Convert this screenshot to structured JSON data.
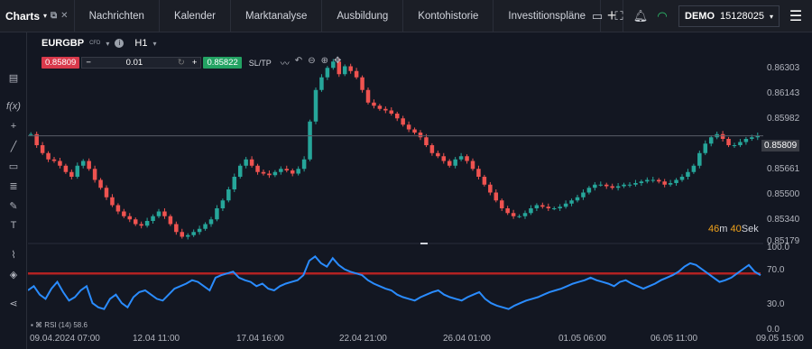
{
  "nav": {
    "brand": "Charts",
    "tabs": [
      "Nachrichten",
      "Kalender",
      "Marktanalyse",
      "Ausbildung",
      "Kontohistorie",
      "Investitionspläne"
    ],
    "plus": "+",
    "account_type": "DEMO",
    "account_number": "15128025"
  },
  "instrument": {
    "symbol": "EURGBP",
    "badge": "CFD",
    "timeframe": "H1",
    "sell_price": "0.85809",
    "buy_price": "0.85822",
    "quantity": "0.01",
    "minus": "−",
    "plus": "+",
    "sltp": "SL/TP"
  },
  "chart_data": {
    "type": "candlestick",
    "y_axis_ticks": [
      "0.86303",
      "0.86143",
      "0.85982",
      "0.85809",
      "0.85661",
      "0.85500",
      "0.85340",
      "0.85179"
    ],
    "current_price": "0.85809",
    "x_axis_ticks": [
      "09.04.2024 07:00",
      "12.04 11:00",
      "17.04 16:00",
      "22.04 21:00",
      "26.04 01:00",
      "01.05 06:00",
      "06.05 11:00",
      "09.05 15:00"
    ],
    "close": [
      0.8582,
      0.8575,
      0.857,
      0.8566,
      0.8565,
      0.8562,
      0.8558,
      0.8555,
      0.8562,
      0.8565,
      0.856,
      0.8553,
      0.8548,
      0.8542,
      0.8537,
      0.8533,
      0.853,
      0.8528,
      0.8525,
      0.8524,
      0.8527,
      0.853,
      0.8533,
      0.853,
      0.8525,
      0.852,
      0.8517,
      0.8518,
      0.852,
      0.8522,
      0.8525,
      0.8528,
      0.8535,
      0.854,
      0.8547,
      0.8555,
      0.8562,
      0.8566,
      0.8562,
      0.8558,
      0.8557,
      0.8556,
      0.8558,
      0.856,
      0.8559,
      0.8557,
      0.856,
      0.8566,
      0.859,
      0.861,
      0.8618,
      0.8624,
      0.8628,
      0.862,
      0.8625,
      0.8622,
      0.8618,
      0.861,
      0.8602,
      0.86,
      0.8598,
      0.8597,
      0.8595,
      0.8592,
      0.8588,
      0.8585,
      0.8583,
      0.858,
      0.8575,
      0.857,
      0.8568,
      0.8565,
      0.8562,
      0.8566,
      0.8568,
      0.8565,
      0.856,
      0.8555,
      0.855,
      0.8545,
      0.854,
      0.8535,
      0.8532,
      0.853,
      0.853,
      0.8532,
      0.8535,
      0.8537,
      0.8536,
      0.8535,
      0.8535,
      0.8536,
      0.8538,
      0.854,
      0.8542,
      0.8545,
      0.8548,
      0.855,
      0.855,
      0.8549,
      0.8548,
      0.8549,
      0.855,
      0.855,
      0.8551,
      0.8552,
      0.8553,
      0.8553,
      0.8552,
      0.855,
      0.8551,
      0.8553,
      0.8555,
      0.8558,
      0.8562,
      0.857,
      0.8576,
      0.858,
      0.8582,
      0.8579,
      0.8575,
      0.8575,
      0.8577,
      0.8579,
      0.858,
      0.8581
    ],
    "rsi": [
      50,
      55,
      45,
      40,
      52,
      60,
      48,
      38,
      42,
      50,
      55,
      35,
      30,
      28,
      40,
      45,
      35,
      30,
      42,
      48,
      50,
      45,
      40,
      38,
      45,
      52,
      55,
      58,
      62,
      60,
      55,
      50,
      65,
      68,
      70,
      72,
      65,
      62,
      60,
      55,
      58,
      52,
      50,
      55,
      58,
      60,
      62,
      68,
      85,
      90,
      82,
      78,
      88,
      80,
      75,
      72,
      70,
      68,
      62,
      58,
      55,
      52,
      50,
      45,
      42,
      40,
      38,
      42,
      45,
      48,
      50,
      45,
      42,
      40,
      38,
      42,
      45,
      48,
      40,
      35,
      32,
      30,
      28,
      32,
      35,
      38,
      40,
      42,
      45,
      48,
      50,
      52,
      55,
      58,
      60,
      62,
      65,
      62,
      60,
      58,
      55,
      60,
      62,
      58,
      55,
      52,
      55,
      58,
      62,
      65,
      68,
      72,
      78,
      82,
      80,
      75,
      70,
      65,
      60,
      62,
      65,
      70,
      75,
      80,
      72,
      68
    ],
    "rsi_name": "RSI (14)",
    "rsi_value": "58.6",
    "rsi_level": 70,
    "rsi_ticks": [
      "100.0",
      "70.0",
      "30.0",
      "0.0"
    ]
  },
  "countdown": {
    "minutes": "46",
    "m": "m",
    "seconds": "40",
    "s": "Sek"
  }
}
